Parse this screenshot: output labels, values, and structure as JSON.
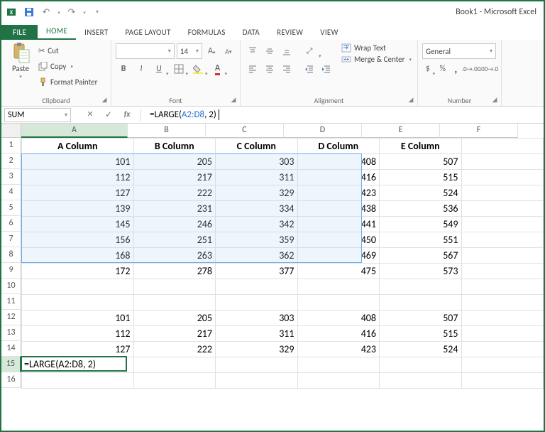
{
  "title": "Book1 - Microsoft Excel",
  "tabs": {
    "file": "FILE",
    "home": "HOME",
    "insert": "INSERT",
    "pageLayout": "PAGE LAYOUT",
    "formulas": "FORMULAS",
    "data": "DATA",
    "review": "REVIEW",
    "view": "VIEW"
  },
  "ribbon": {
    "clipboard": {
      "paste": "Paste",
      "cut": "Cut",
      "copy": "Copy",
      "formatPainter": "Format Painter",
      "label": "Clipboard"
    },
    "font": {
      "fontName": "",
      "fontSize": "14",
      "bold": "B",
      "italic": "I",
      "underline": "U",
      "label": "Font"
    },
    "alignment": {
      "wrapText": "Wrap Text",
      "mergeCenter": "Merge & Center",
      "label": "Alignment"
    },
    "number": {
      "format": "General",
      "label": "Number",
      "currency": "$",
      "percent": "%",
      "comma": ","
    }
  },
  "formulaBar": {
    "name": "SUM",
    "cancel": "✕",
    "enter": "✓",
    "fx": "fx",
    "prefix": "=LARGE(",
    "ref": "A2:D8",
    "suffix": ", 2)"
  },
  "colWidths": {
    "A": 150,
    "B": 110,
    "C": 110,
    "D": 110,
    "E": 110,
    "F": 110
  },
  "columns": [
    "A",
    "B",
    "C",
    "D",
    "E",
    "F"
  ],
  "rows": 16,
  "headers": [
    "A Column",
    "B Column",
    "C Column",
    "D Column",
    "E Column"
  ],
  "block1": [
    [
      101,
      205,
      303,
      408,
      507
    ],
    [
      112,
      217,
      311,
      416,
      515
    ],
    [
      127,
      222,
      329,
      423,
      524
    ],
    [
      139,
      231,
      334,
      438,
      536
    ],
    [
      145,
      246,
      342,
      441,
      549
    ],
    [
      156,
      251,
      359,
      450,
      551
    ],
    [
      168,
      263,
      362,
      469,
      567
    ],
    [
      172,
      278,
      377,
      475,
      573
    ]
  ],
  "block2": [
    [
      101,
      205,
      303,
      408,
      507
    ],
    [
      112,
      217,
      311,
      416,
      515
    ],
    [
      127,
      222,
      329,
      423,
      524
    ]
  ],
  "activeCell": "=LARGE(A2:D8, 2)",
  "chart_data": {
    "type": "table",
    "title": "",
    "columns": [
      "A Column",
      "B Column",
      "C Column",
      "D Column",
      "E Column"
    ],
    "rows": [
      [
        101,
        205,
        303,
        408,
        507
      ],
      [
        112,
        217,
        311,
        416,
        515
      ],
      [
        127,
        222,
        329,
        423,
        524
      ],
      [
        139,
        231,
        334,
        438,
        536
      ],
      [
        145,
        246,
        342,
        441,
        549
      ],
      [
        156,
        251,
        359,
        450,
        551
      ],
      [
        168,
        263,
        362,
        469,
        567
      ],
      [
        172,
        278,
        377,
        475,
        573
      ]
    ],
    "formula": "=LARGE(A2:D8, 2)"
  }
}
